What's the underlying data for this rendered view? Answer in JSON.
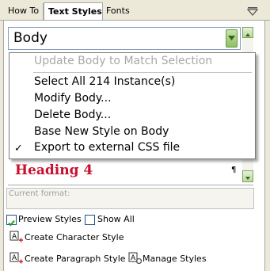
{
  "tabs": [
    {
      "label": "How To"
    },
    {
      "label": "Text Styles"
    },
    {
      "label": "Fonts"
    }
  ],
  "style_select": {
    "value": "Body"
  },
  "context_menu": {
    "items": [
      {
        "label": "Update Body to Match Selection",
        "enabled": false
      },
      {
        "label": "Select All 214 Instance(s)",
        "enabled": true
      },
      {
        "label": "Modify Body...",
        "enabled": true
      },
      {
        "label": "Delete Body...",
        "enabled": true
      },
      {
        "label": "Base New Style on Body",
        "enabled": true
      },
      {
        "label": "Export to external CSS file",
        "enabled": true,
        "checked": true
      }
    ]
  },
  "preview": {
    "heading": "Heading 4",
    "pilcrow": "¶"
  },
  "current_format": {
    "label": "Current format:"
  },
  "options": {
    "preview_styles": {
      "label": "Preview Styles",
      "checked": true
    },
    "show_all": {
      "label": "Show All",
      "checked": false
    }
  },
  "actions": {
    "create_character": "Create Character Style",
    "create_paragraph": "Create Paragraph Style",
    "manage": "Manage Styles"
  },
  "colors": {
    "heading": "#c8102e",
    "accent_green": "#8fbf67"
  }
}
